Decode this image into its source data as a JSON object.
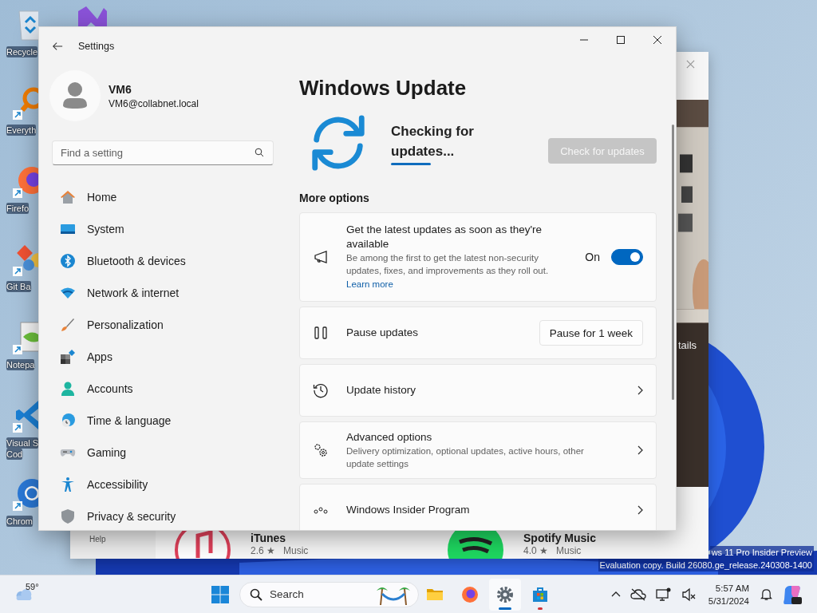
{
  "desktop": {
    "icons": [
      {
        "label_lines": [
          "Recycle"
        ]
      },
      {
        "label_lines": [
          "Everyth"
        ]
      },
      {
        "label_lines": [
          "Firefo"
        ]
      },
      {
        "label_lines": [
          "Git Ba"
        ]
      },
      {
        "label_lines": [
          "Notepa"
        ]
      },
      {
        "label_lines": [
          "Visual S",
          "Cod"
        ]
      },
      {
        "label_lines": [
          "Chrom"
        ]
      }
    ],
    "watermark": [
      "ws 11 Pro Insider Preview",
      "Evaluation copy. Build 26080.ge_release.240308-1400"
    ]
  },
  "store_window": {
    "partial_label": "tails",
    "nav_item": "Help",
    "apps": [
      {
        "name": "iTunes",
        "rating": "2.6 ★",
        "category": "Music"
      },
      {
        "name": "Spotify Music",
        "rating": "4.0 ★",
        "category": "Music"
      }
    ]
  },
  "settings": {
    "title": "Settings",
    "account": {
      "name": "VM6",
      "email": "VM6@collabnet.local"
    },
    "search": {
      "placeholder": "Find a setting"
    },
    "nav": [
      {
        "label": "Home",
        "selected": false
      },
      {
        "label": "System",
        "selected": false
      },
      {
        "label": "Bluetooth & devices",
        "selected": false
      },
      {
        "label": "Network & internet",
        "selected": false
      },
      {
        "label": "Personalization",
        "selected": false
      },
      {
        "label": "Apps",
        "selected": false
      },
      {
        "label": "Accounts",
        "selected": false
      },
      {
        "label": "Time & language",
        "selected": false
      },
      {
        "label": "Gaming",
        "selected": false
      },
      {
        "label": "Accessibility",
        "selected": false
      },
      {
        "label": "Privacy & security",
        "selected": false
      }
    ],
    "page": {
      "title": "Windows Update",
      "status": "Checking for updates...",
      "check_button": {
        "label": "Check for updates",
        "disabled": true
      },
      "section_title": "More options",
      "options": [
        {
          "kind": "toggle",
          "title": "Get the latest updates as soon as they're available",
          "description": "Be among the first to get the latest non-security updates, fixes, and improvements as they roll out.",
          "link": "Learn more",
          "state_label": "On",
          "on": true
        },
        {
          "kind": "button",
          "title": "Pause updates",
          "button": "Pause for 1 week"
        },
        {
          "kind": "link",
          "title": "Update history"
        },
        {
          "kind": "link",
          "title": "Advanced options",
          "description": "Delivery optimization, optional updates, active hours, other update settings"
        },
        {
          "kind": "link",
          "title": "Windows Insider Program"
        }
      ]
    }
  },
  "taskbar": {
    "weather": {
      "temperature": "59°"
    },
    "search": {
      "placeholder": "Search"
    },
    "apps": [
      {
        "active": false,
        "attention": false
      },
      {
        "active": false,
        "attention": false
      },
      {
        "active": true,
        "attention": false
      },
      {
        "active": false,
        "attention": true
      }
    ],
    "clock": {
      "time": "5:57 AM",
      "date": "5/31/2024"
    }
  }
}
